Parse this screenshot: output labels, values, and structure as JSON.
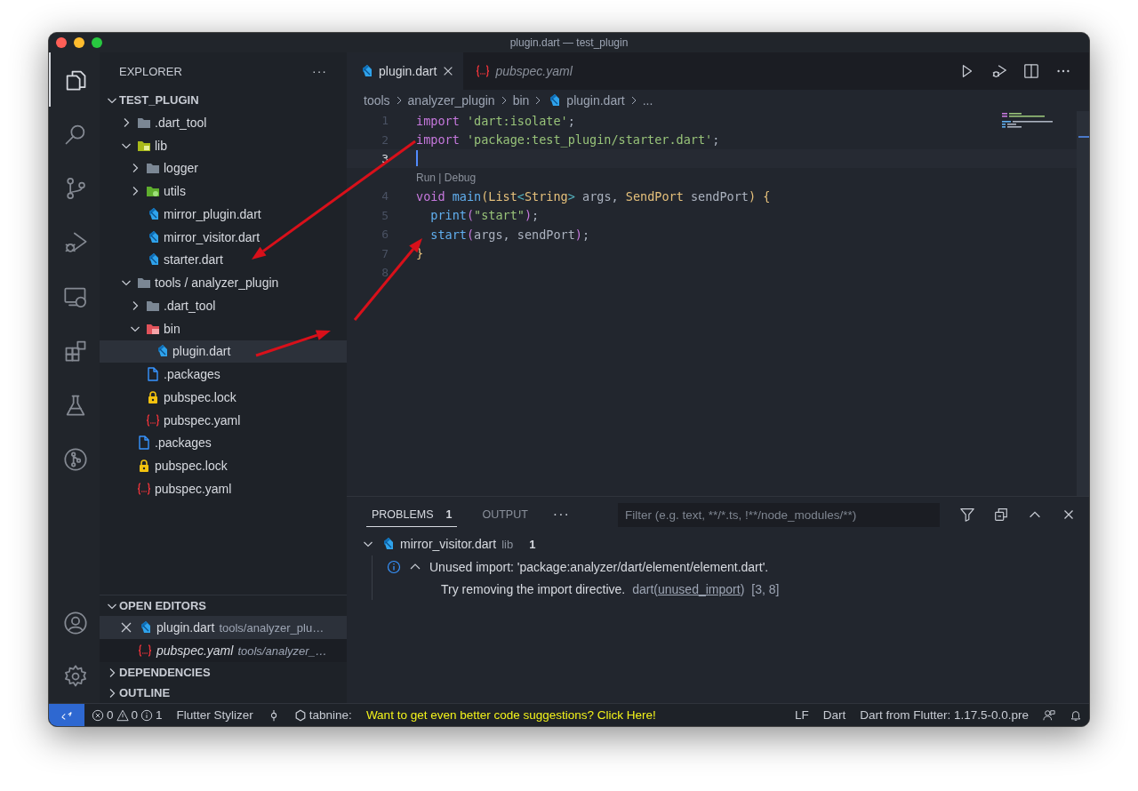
{
  "window": {
    "title": "plugin.dart — test_plugin"
  },
  "activity_bar": {
    "top": [
      {
        "kind": "explorer",
        "selected": true
      },
      {
        "kind": "search",
        "selected": false
      },
      {
        "kind": "scm",
        "selected": false
      },
      {
        "kind": "debug",
        "selected": false
      },
      {
        "kind": "remote",
        "selected": false
      },
      {
        "kind": "extensions",
        "selected": false
      },
      {
        "kind": "testing",
        "selected": false
      },
      {
        "kind": "gitgraph",
        "selected": false
      }
    ],
    "bottom": [
      {
        "kind": "account"
      },
      {
        "kind": "settings"
      }
    ]
  },
  "sidebar": {
    "title": "EXPLORER",
    "more": "···",
    "root": {
      "label": "TEST_PLUGIN",
      "expanded": true
    },
    "tree": [
      {
        "label": ".dart_tool",
        "kind": "folder",
        "expanded": false,
        "selected": false
      },
      {
        "label": "lib",
        "kind": "folder-lib",
        "expanded": true,
        "selected": false,
        "children": [
          {
            "label": "logger",
            "kind": "folder",
            "expanded": false,
            "selected": false
          },
          {
            "label": "utils",
            "kind": "folder-utils",
            "expanded": false,
            "selected": false
          },
          {
            "label": "mirror_plugin.dart",
            "kind": "dart",
            "selected": false
          },
          {
            "label": "mirror_visitor.dart",
            "kind": "dart",
            "selected": false
          },
          {
            "label": "starter.dart",
            "kind": "dart",
            "selected": false
          }
        ]
      },
      {
        "label": "tools / analyzer_plugin",
        "kind": "folder",
        "expanded": true,
        "selected": false,
        "children": [
          {
            "label": ".dart_tool",
            "kind": "folder",
            "expanded": false,
            "selected": false
          },
          {
            "label": "bin",
            "kind": "folder-bin",
            "expanded": true,
            "selected": false,
            "children": [
              {
                "label": "plugin.dart",
                "kind": "dart",
                "selected": true
              }
            ]
          },
          {
            "label": ".packages",
            "kind": "file",
            "selected": false
          },
          {
            "label": "pubspec.lock",
            "kind": "lock",
            "selected": false
          },
          {
            "label": "pubspec.yaml",
            "kind": "yaml",
            "selected": false
          }
        ]
      },
      {
        "label": ".packages",
        "kind": "file",
        "selected": false
      },
      {
        "label": "pubspec.lock",
        "kind": "lock",
        "selected": false
      },
      {
        "label": "pubspec.yaml",
        "kind": "yaml",
        "selected": false
      }
    ],
    "open_editors": {
      "label": "OPEN EDITORS",
      "expanded": true,
      "items": [
        {
          "name": "plugin.dart",
          "path": "tools/analyzer_plu…",
          "kind": "dart",
          "selected": true,
          "preview": false
        },
        {
          "name": "pubspec.yaml",
          "path": "tools/analyzer_…",
          "kind": "yaml",
          "selected": false,
          "preview": true
        }
      ]
    },
    "sections": [
      {
        "label": "DEPENDENCIES",
        "expanded": false
      },
      {
        "label": "OUTLINE",
        "expanded": false
      }
    ]
  },
  "tabs": [
    {
      "label": "plugin.dart",
      "kind": "dart",
      "selected": true,
      "preview": false
    },
    {
      "label": "pubspec.yaml",
      "kind": "yaml",
      "selected": false,
      "preview": true
    }
  ],
  "editor_actions": [
    {
      "kind": "run"
    },
    {
      "kind": "debug"
    },
    {
      "kind": "split"
    },
    {
      "kind": "more"
    }
  ],
  "breadcrumbs": [
    {
      "label": "tools",
      "kind": "folder"
    },
    {
      "label": "analyzer_plugin",
      "kind": "folder"
    },
    {
      "label": "bin",
      "kind": "folder"
    },
    {
      "label": "plugin.dart",
      "kind": "dart"
    },
    {
      "label": "...",
      "kind": "symbol"
    }
  ],
  "editor": {
    "lines": [
      {
        "number": "1",
        "current": false,
        "tokens": [
          {
            "text": "import",
            "kind": "kw"
          },
          {
            "text": " 'dart:isolate'",
            "kind": "str"
          },
          {
            "text": ";",
            "kind": "plain"
          }
        ]
      },
      {
        "number": "2",
        "current": false,
        "tokens": [
          {
            "text": "import",
            "kind": "kw"
          },
          {
            "text": " 'package:test_plugin/starter.dart'",
            "kind": "str"
          },
          {
            "text": ";",
            "kind": "plain"
          }
        ]
      },
      {
        "number": "3",
        "current": true,
        "codelens": "Run | Debug"
      },
      {
        "number": "4",
        "current": false,
        "tokens": [
          {
            "text": "void",
            "kind": "kw"
          },
          {
            "text": " main",
            "kind": "fn"
          },
          {
            "text": "(",
            "kind": "br1"
          },
          {
            "text": "List",
            "kind": "type"
          },
          {
            "text": "<",
            "kind": "op"
          },
          {
            "text": "String",
            "kind": "type"
          },
          {
            "text": ">",
            "kind": "op"
          },
          {
            "text": " args, ",
            "kind": "plain"
          },
          {
            "text": "SendPort",
            "kind": "type"
          },
          {
            "text": " sendPort",
            "kind": "plain"
          },
          {
            "text": ")",
            "kind": "br1"
          },
          {
            "text": " {",
            "kind": "br1"
          }
        ]
      },
      {
        "number": "5",
        "current": false,
        "tokens": [
          {
            "text": "  print",
            "kind": "fn"
          },
          {
            "text": "(",
            "kind": "br2"
          },
          {
            "text": "\"start\"",
            "kind": "str"
          },
          {
            "text": ")",
            "kind": "br2"
          },
          {
            "text": ";",
            "kind": "plain"
          }
        ]
      },
      {
        "number": "6",
        "current": false,
        "tokens": [
          {
            "text": "  start",
            "kind": "fn"
          },
          {
            "text": "(",
            "kind": "br2"
          },
          {
            "text": "args, sendPort",
            "kind": "plain"
          },
          {
            "text": ")",
            "kind": "br2"
          },
          {
            "text": ";",
            "kind": "plain"
          }
        ]
      },
      {
        "number": "7",
        "current": false,
        "tokens": [
          {
            "text": "}",
            "kind": "br1"
          }
        ]
      },
      {
        "number": "8",
        "current": false
      }
    ]
  },
  "panel": {
    "tabs": [
      {
        "label": "PROBLEMS",
        "count": "1",
        "selected": true
      },
      {
        "label": "OUTPUT",
        "selected": false
      }
    ],
    "more": "···",
    "filter": {
      "placeholder": "Filter (e.g. text, **/*.ts, !**/node_modules/**)"
    },
    "actions": [
      {
        "kind": "filter"
      },
      {
        "kind": "collapse"
      },
      {
        "kind": "maximize"
      },
      {
        "kind": "close"
      }
    ],
    "problems": [
      {
        "file": "mirror_visitor.dart",
        "folder": "lib",
        "count": "1",
        "expanded": true,
        "items": [
          {
            "kind": "info",
            "expanded": true,
            "message": "Unused import: 'package:analyzer/dart/element/element.dart'.",
            "detail": "Try removing the import directive.",
            "source_before": "dart(",
            "code": "unused_import",
            "source_after": ")",
            "location": "[3, 8]"
          }
        ]
      }
    ]
  },
  "status_bar": {
    "left": [
      {
        "kind": "remote"
      },
      {
        "kind": "problems",
        "errors": "0",
        "warnings": "0",
        "infos": "1"
      },
      {
        "kind": "text",
        "text": "Flutter Stylizer"
      },
      {
        "kind": "commit"
      },
      {
        "kind": "tabnine",
        "text": "tabnine:"
      },
      {
        "kind": "promo",
        "text": "Want to get even better code suggestions? Click Here!"
      }
    ],
    "right": [
      {
        "kind": "text",
        "text": "LF"
      },
      {
        "kind": "text",
        "text": "Dart"
      },
      {
        "kind": "text",
        "text": "Dart from Flutter: 1.17.5-0.0.pre"
      },
      {
        "kind": "feedback"
      },
      {
        "kind": "bell"
      }
    ]
  }
}
